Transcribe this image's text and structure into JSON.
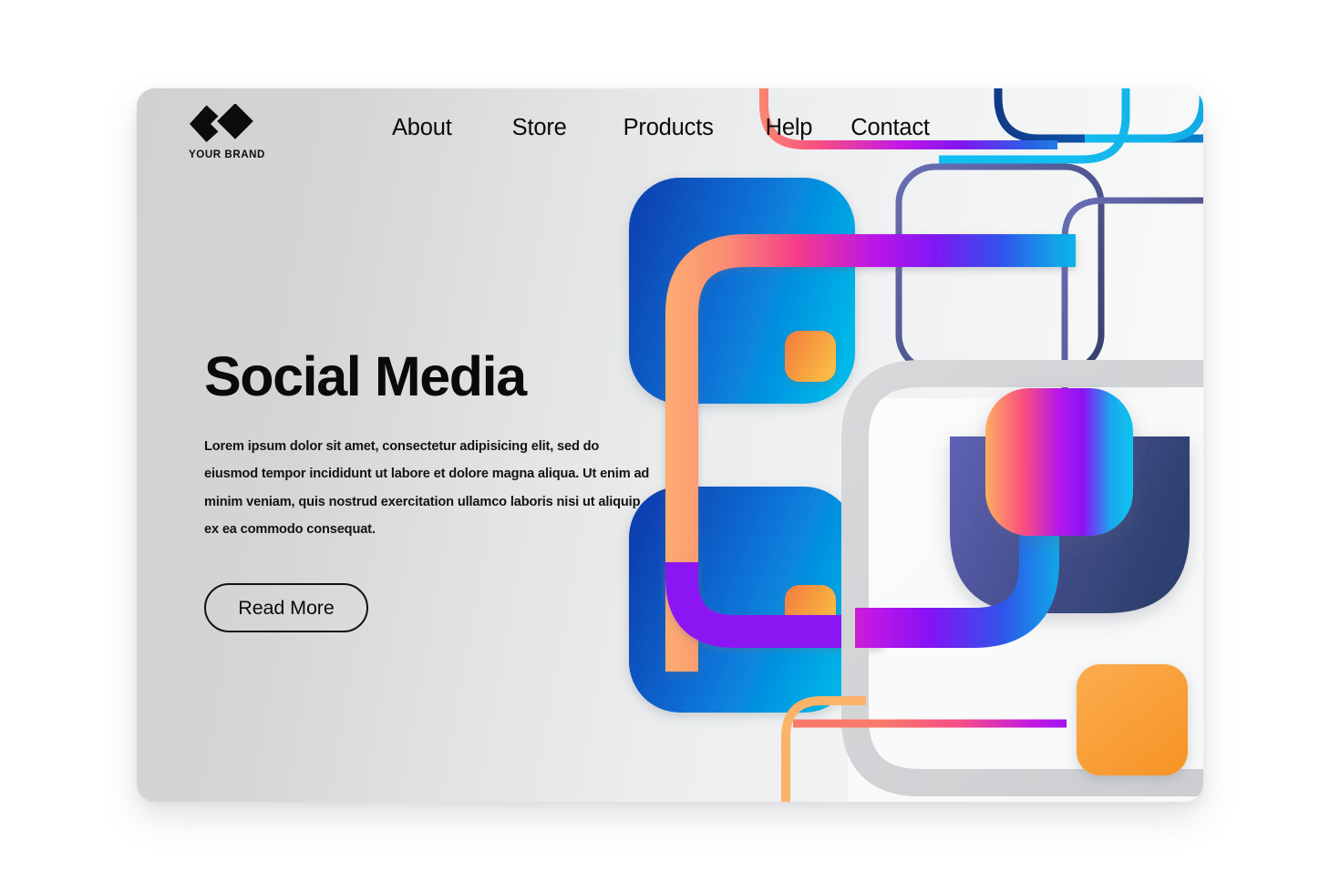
{
  "brand": {
    "name": "YOUR BRAND",
    "logo_icon": "double-diamond-logo-icon"
  },
  "nav": {
    "items": [
      {
        "label": "About"
      },
      {
        "label": "Store"
      },
      {
        "label": "Products"
      },
      {
        "label": "Help"
      },
      {
        "label": "Contact"
      }
    ]
  },
  "hero": {
    "title": "Social Media",
    "paragraph": "Lorem ipsum dolor sit amet, consectetur adipisicing elit, sed do eiusmod tempor incididunt ut labore et dolore magna aliqua. Ut enim ad minim veniam, quis nostrud exercitation ullamco laboris nisi ut aliquip ex ea commodo consequat.",
    "cta_label": "Read More"
  },
  "colors": {
    "card_background_light": "#fbfbfb",
    "card_background_dark": "#cfd1d3",
    "text_primary": "#0a0a0c",
    "blue_dark": "#0b4fbe",
    "blue_light": "#00b3e6",
    "orange": "#f9a24a",
    "orange_deep": "#f7941d",
    "pink": "#f8368a",
    "magenta": "#b713e6",
    "purple": "#8a12f0",
    "violet": "#6b4fd8",
    "navy": "#3c4d80",
    "indigo": "#5a5fb5",
    "cyan": "#18b9ec",
    "gray_outline": "#d5d6d8",
    "navy_outline": "#4e5789"
  }
}
